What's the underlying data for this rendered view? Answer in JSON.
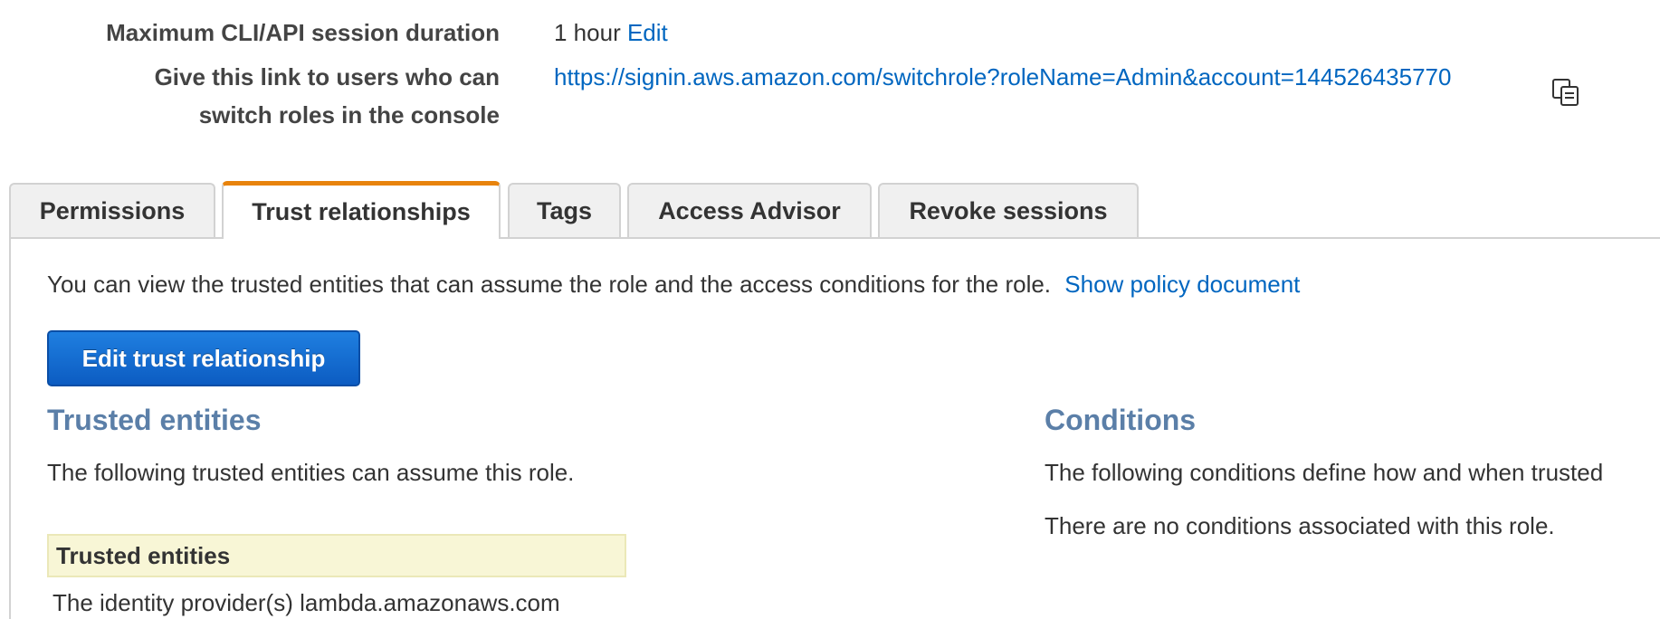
{
  "summary": {
    "session_duration_label": "Maximum CLI/API session duration",
    "session_duration_value": "1 hour",
    "session_duration_edit": "Edit",
    "switch_link_label_line1": "Give this link to users who can",
    "switch_link_label_line2": "switch roles in the console",
    "switch_link_url": "https://signin.aws.amazon.com/switchrole?roleName=Admin&account=144526435770",
    "copy_icon": "copy-clipboard-icon"
  },
  "tabs": [
    {
      "label": "Permissions",
      "active": false
    },
    {
      "label": "Trust relationships",
      "active": true
    },
    {
      "label": "Tags",
      "active": false
    },
    {
      "label": "Access Advisor",
      "active": false
    },
    {
      "label": "Revoke sessions",
      "active": false
    }
  ],
  "trust": {
    "description": "You can view the trusted entities that can assume the role and the access conditions for the role.",
    "show_policy_link": "Show policy document",
    "edit_button": "Edit trust relationship",
    "trusted_entities_title": "Trusted entities",
    "trusted_entities_text": "The following trusted entities can assume this role.",
    "table_header": "Trusted entities",
    "table_rows": [
      "The identity provider(s) lambda.amazonaws.com"
    ],
    "conditions_title": "Conditions",
    "conditions_text": "The following conditions define how and when trusted",
    "conditions_empty": "There are no conditions associated with this role."
  },
  "colors": {
    "link": "#0066c0",
    "active_tab_accent": "#e8830c",
    "section_title": "#5b7fa8",
    "primary_button": "#0c5cc2",
    "table_header_bg": "#f8f6d6"
  }
}
